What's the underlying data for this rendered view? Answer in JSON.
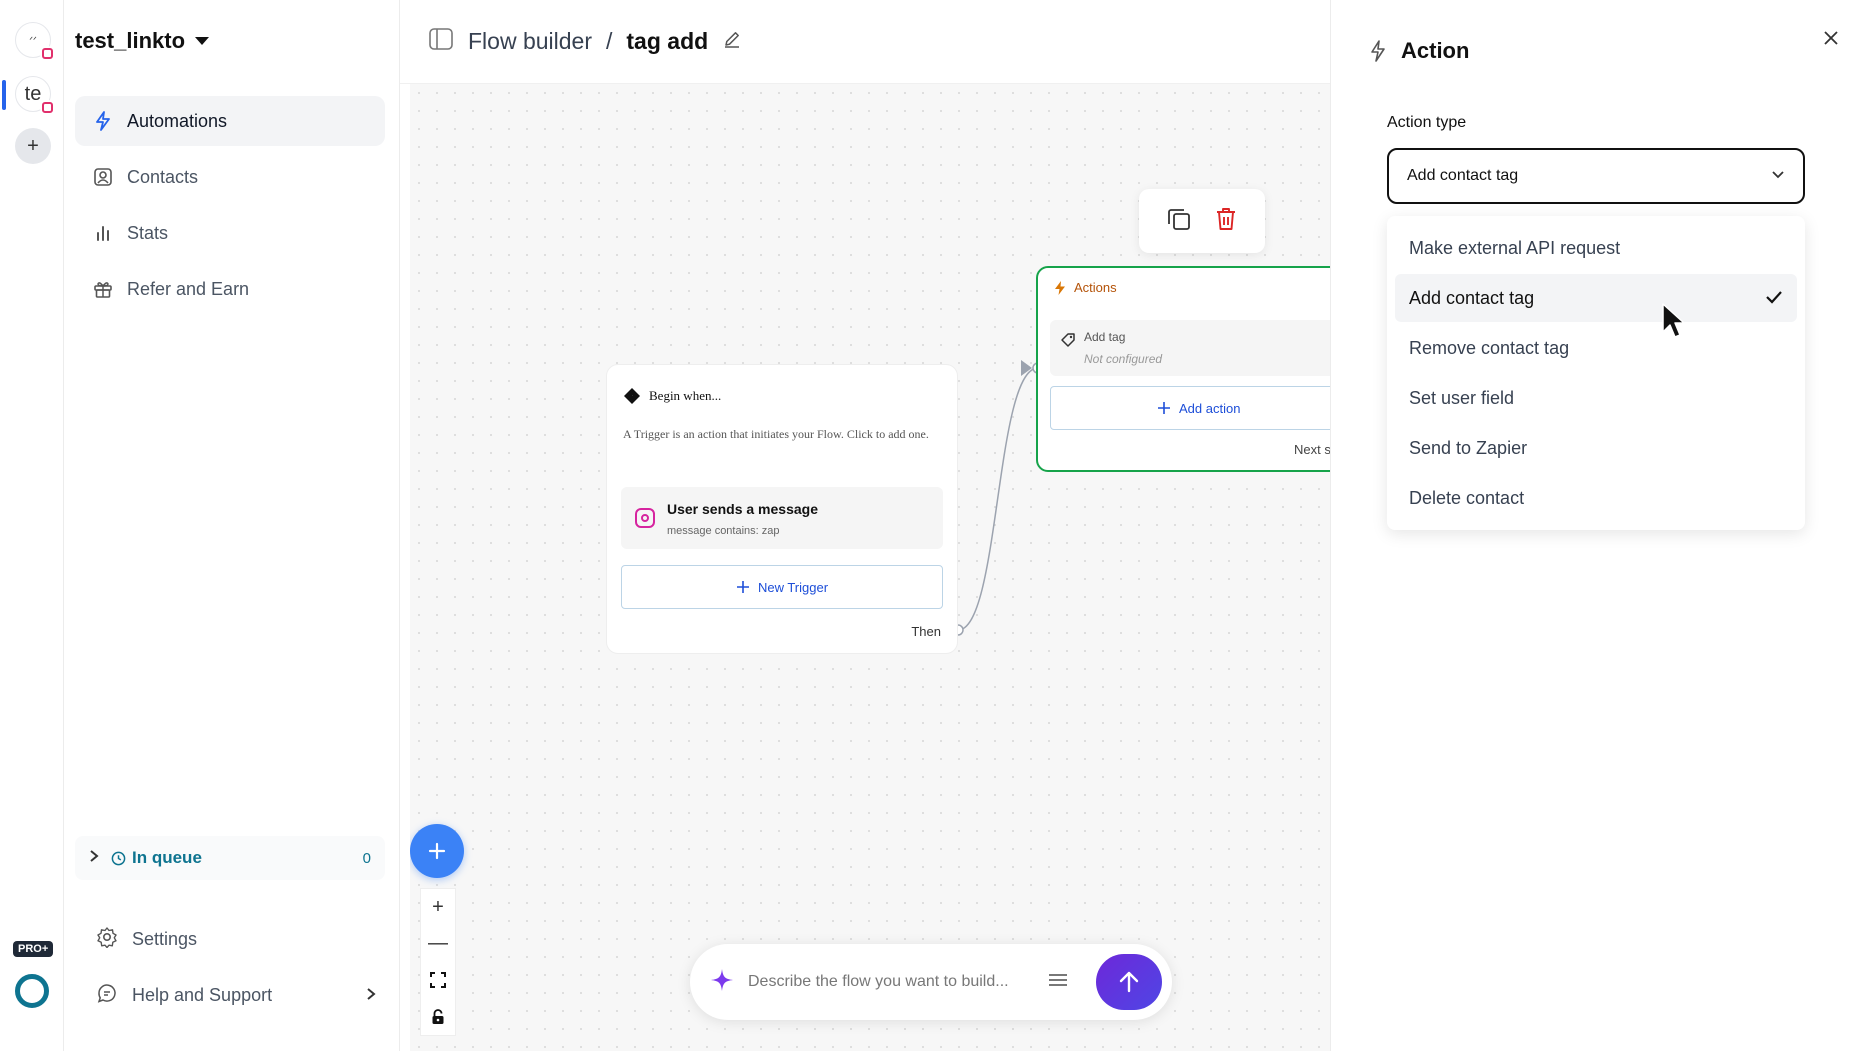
{
  "account": {
    "name": "test_linkto"
  },
  "rail": {
    "avatar1_text": "ᐟᐟ",
    "avatar2_text": "te",
    "add_symbol": "+",
    "pro_badge": "PRO+"
  },
  "sidebar": {
    "nav": [
      {
        "label": "Automations",
        "icon": "bolt-icon",
        "active": true
      },
      {
        "label": "Contacts",
        "icon": "contact-icon"
      },
      {
        "label": "Stats",
        "icon": "bar-chart-icon"
      },
      {
        "label": "Refer and Earn",
        "icon": "gift-icon"
      }
    ],
    "queue": {
      "label": "In queue",
      "count": "0"
    },
    "settings": "Settings",
    "help": "Help and Support"
  },
  "header": {
    "breadcrumb_root": "Flow builder",
    "separator": "/",
    "flow_name": "tag add"
  },
  "canvas": {
    "trigger": {
      "title": "Begin when...",
      "description": "A Trigger is an action that initiates your Flow. Click to add one.",
      "item_title": "User sends a message",
      "item_subtitle": "message contains: zap",
      "new_trigger": "New Trigger",
      "then": "Then"
    },
    "actions": {
      "title": "Actions",
      "step_title": "Add tag",
      "step_status": "Not configured",
      "add_action": "Add action",
      "next": "Next s"
    },
    "zoom": {
      "plus": "+",
      "minus": "—"
    },
    "prompt": {
      "placeholder": "Describe the flow you want to build..."
    }
  },
  "panel": {
    "title": "Action",
    "field_label": "Action type",
    "selected_value": "Add contact tag",
    "options": [
      {
        "label": "Make external API request"
      },
      {
        "label": "Add contact tag",
        "selected": true
      },
      {
        "label": "Remove contact tag"
      },
      {
        "label": "Set user field"
      },
      {
        "label": "Send to Zapier"
      },
      {
        "label": "Delete contact"
      }
    ]
  },
  "colors": {
    "accent": "#3b82f6",
    "success": "#16a34a",
    "danger": "#dc2626",
    "queue": "#0e7490",
    "send_gradient": "#6d28d9"
  }
}
